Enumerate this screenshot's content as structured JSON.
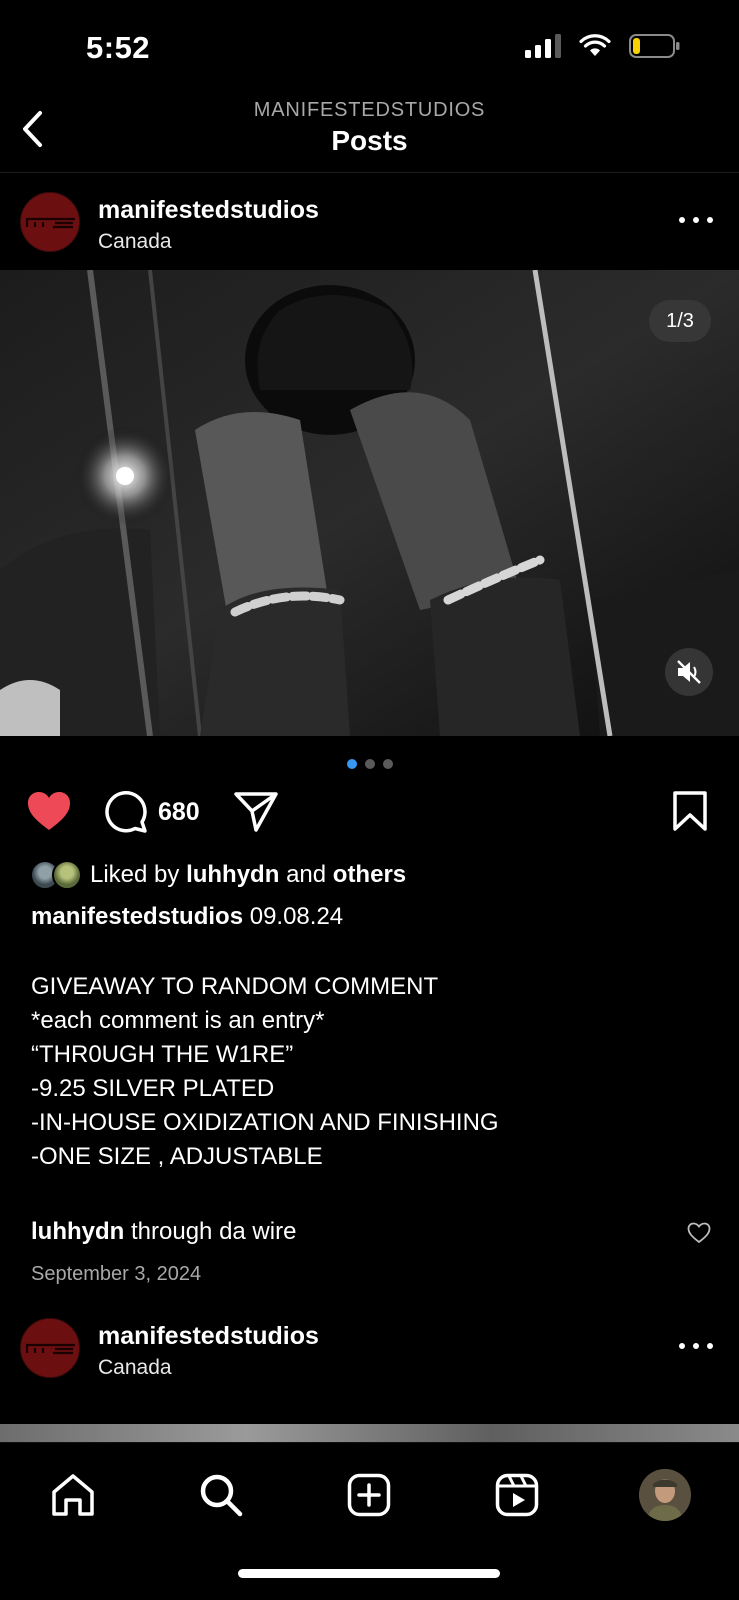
{
  "status_bar": {
    "time": "5:52"
  },
  "header": {
    "subtitle": "MANIFESTEDSTUDIOS",
    "title": "Posts"
  },
  "post": {
    "username": "manifestedstudios",
    "location": "Canada",
    "media_counter": "1/3",
    "carousel": {
      "count": 3,
      "active_index": 0
    },
    "comment_count": "680",
    "liked_by": {
      "prefix": "Liked by",
      "user": "luhhydn",
      "middle": "and",
      "others": "others"
    },
    "caption": {
      "username": "manifestedstudios",
      "date_text": "09.08.24",
      "lines": [
        "GIVEAWAY TO RANDOM COMMENT",
        "*each comment is an entry*",
        "",
        "“THR0UGH THE W1RE”",
        "-9.25 SILVER PLATED",
        "-IN-HOUSE OXIDIZATION AND FINISHING",
        "-ONE SIZE , ADJUSTABLE"
      ]
    },
    "top_comment": {
      "username": "luhhydn",
      "text": "through da wire"
    },
    "posted_date": "September 3, 2024"
  },
  "next_post": {
    "username": "manifestedstudios",
    "location": "Canada"
  },
  "icons": {
    "back": "chevron-left-icon",
    "more": "more-horizontal-icon",
    "like": "heart-filled-icon",
    "comment": "comment-bubble-icon",
    "share": "paper-plane-icon",
    "save": "bookmark-icon",
    "mute": "speaker-muted-icon",
    "tabs": [
      "home-icon",
      "search-icon",
      "create-plus-icon",
      "reels-icon",
      "profile-avatar"
    ]
  },
  "colors": {
    "like_red": "#ed4956",
    "dot_active": "#3897f0",
    "avatar_red": "#6b0f10",
    "background": "#000000"
  }
}
